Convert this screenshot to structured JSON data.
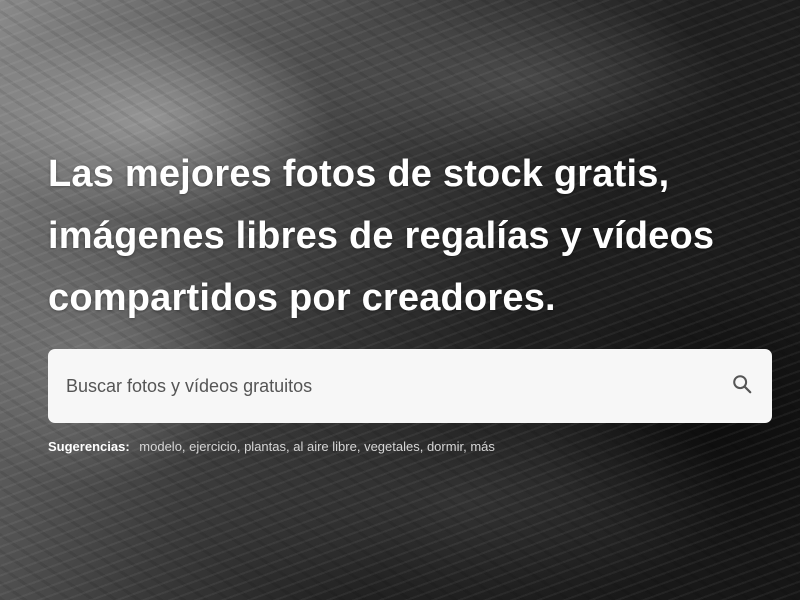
{
  "hero": {
    "headline_lines": [
      "Las mejores fotos de stock gratis,",
      "imágenes libres de regalías y vídeos",
      "compartidos por creadores."
    ]
  },
  "search": {
    "placeholder": "Buscar fotos y vídeos gratuitos",
    "icon": "search-icon"
  },
  "suggestions": {
    "label": "Sugerencias:",
    "items": [
      "modelo",
      "ejercicio",
      "plantas",
      "al aire libre",
      "vegetales",
      "dormir",
      "más"
    ]
  },
  "colors": {
    "headline": "#ffffff",
    "search_bg": "#f7f7f7",
    "icon": "#555555"
  }
}
